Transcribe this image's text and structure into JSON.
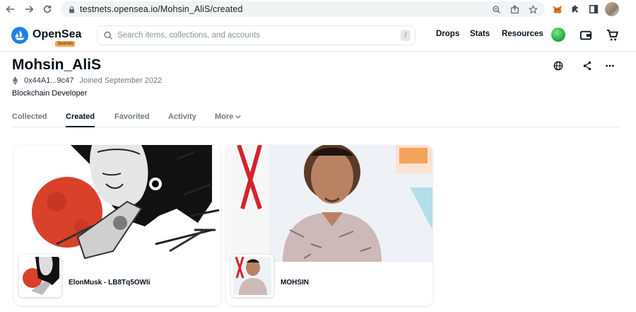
{
  "browser": {
    "url": "testnets.opensea.io/Mohsin_AliS/created"
  },
  "header": {
    "brand": "OpenSea",
    "badge": "Testnets",
    "search_placeholder": "Search items, collections, and accounts",
    "search_shortcut": "/",
    "nav": [
      "Drops",
      "Stats",
      "Resources"
    ]
  },
  "profile": {
    "name": "Mohsin_AliS",
    "address": "0x44A1...9c47",
    "joined": "Joined September 2022",
    "bio": "Blockchain Developer"
  },
  "tabs": {
    "collected": "Collected",
    "created": "Created",
    "favorited": "Favorited",
    "activity": "Activity",
    "more": "More"
  },
  "cards": [
    {
      "name": "ElonMusk - LB8Tq5OWIi"
    },
    {
      "name": "MOHSIN"
    }
  ],
  "colors": {
    "accent": "#2081e2",
    "text": "#04111d",
    "muted": "#707a83"
  }
}
